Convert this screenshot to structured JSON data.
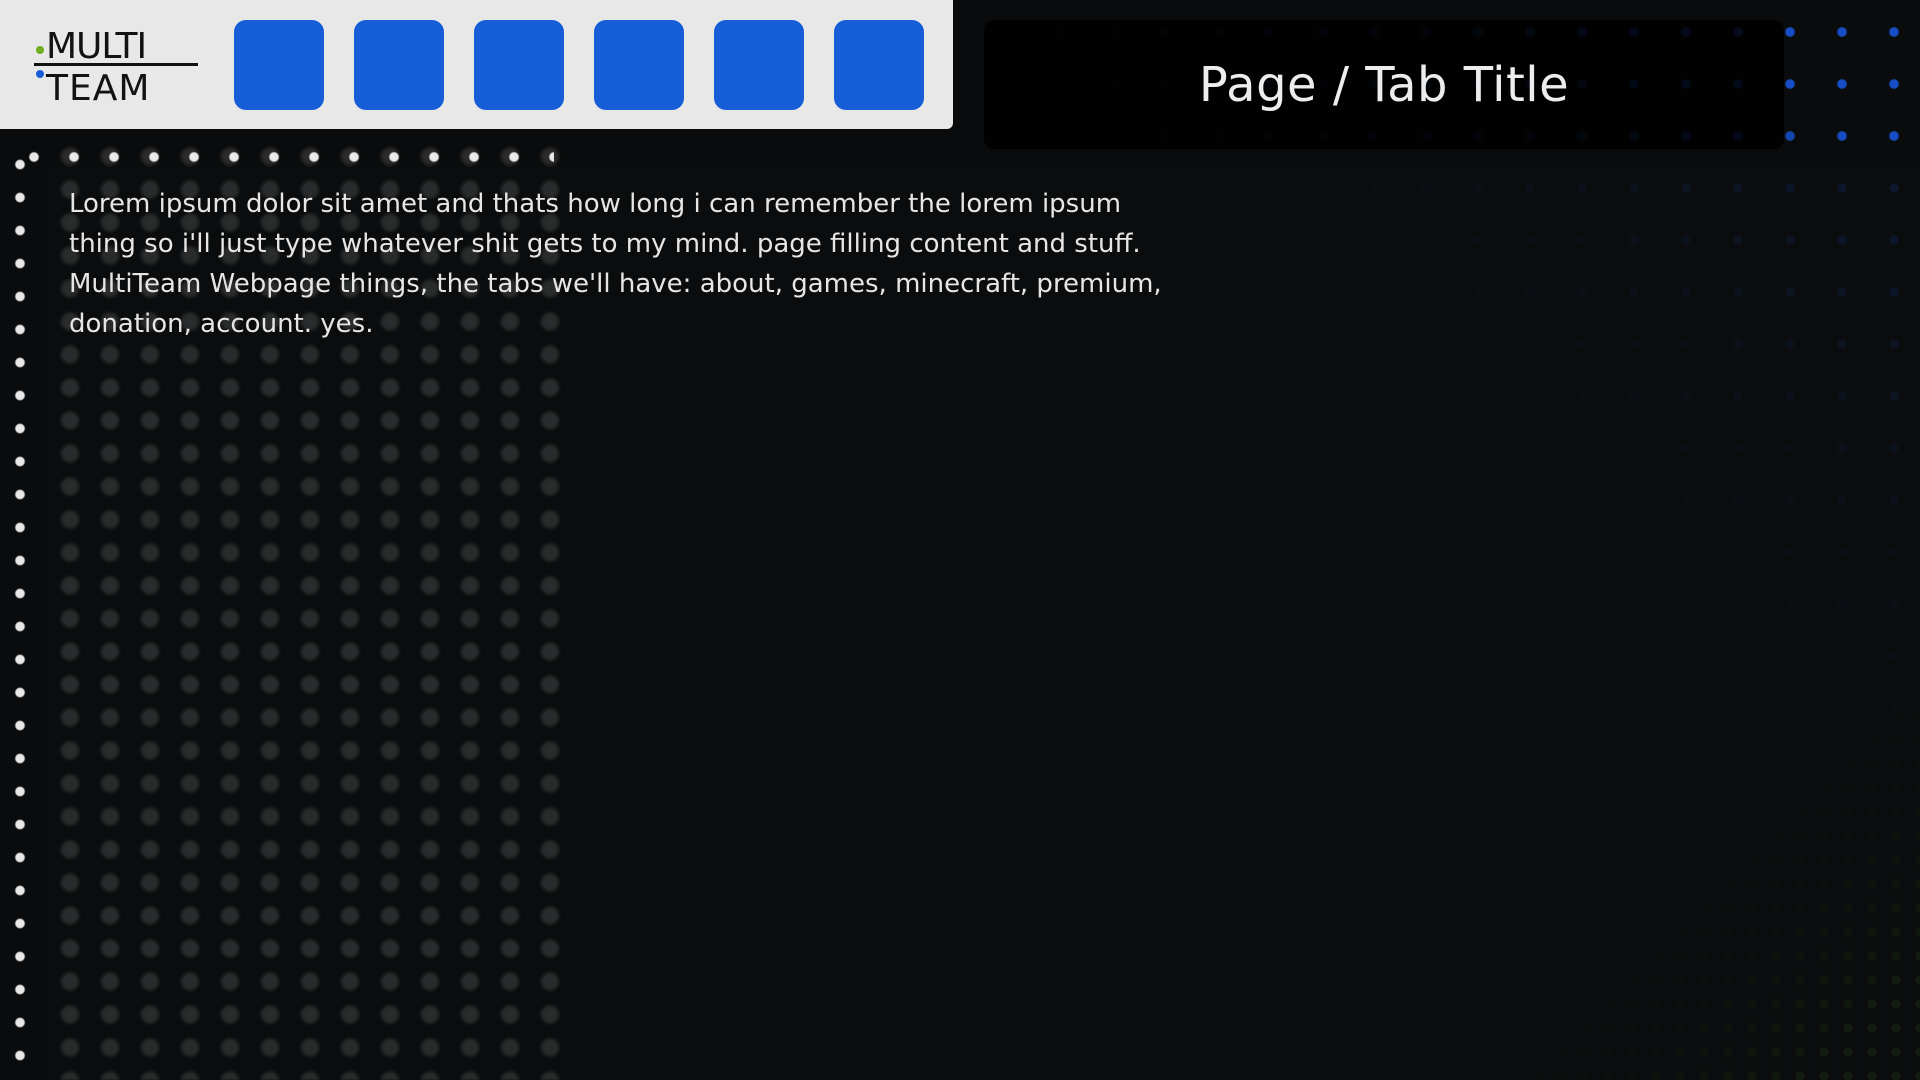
{
  "header": {
    "logo": {
      "line1": "MULTI",
      "line2": "TEAM"
    },
    "nav_buttons": [
      "",
      "",
      "",
      "",
      "",
      ""
    ],
    "title": "Page / Tab Title"
  },
  "main": {
    "body": "Lorem ipsum dolor sit amet and thats how long i can remember the lorem ipsum thing so i'll just type whatever shit gets to my mind. page filling content and stuff. MultiTeam Webpage things, the tabs we'll have: about, games, minecraft, premium, donation, account. yes."
  },
  "colors": {
    "accent_blue": "#155ed8",
    "accent_green": "#6fae1f",
    "background": "#0a0b0c",
    "header_bg": "#e8e8e8"
  }
}
